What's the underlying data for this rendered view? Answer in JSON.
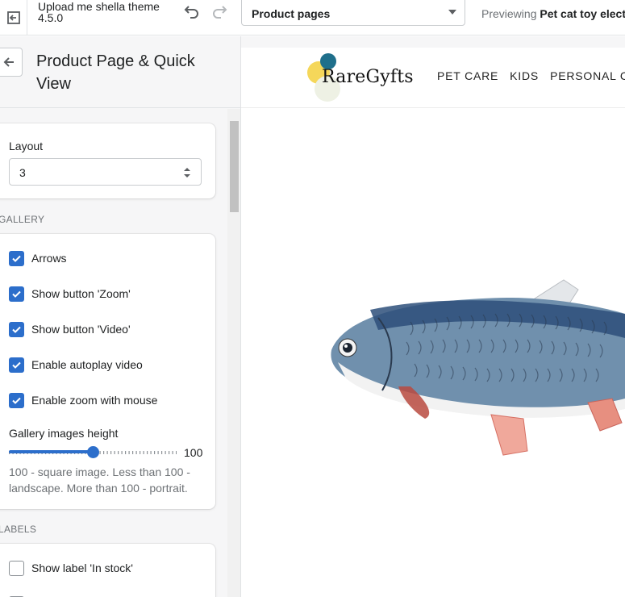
{
  "topbar": {
    "exit_icon": "exit-icon",
    "theme_name": "Upload me shella theme 4.5.0",
    "undo_icon": "undo-icon",
    "redo_icon": "redo-icon",
    "page_select": {
      "value": "Product pages"
    },
    "preview_prefix": "Previewing",
    "preview_product": "Pet cat toy electr"
  },
  "sidebar": {
    "back_icon": "arrow-left-icon",
    "title": "Product Page & Quick View",
    "layout": {
      "label": "Layout",
      "value": "3"
    },
    "gallery_heading": "GALLERY",
    "gallery_options": [
      {
        "label": "Arrows",
        "checked": true
      },
      {
        "label": "Show button 'Zoom'",
        "checked": true
      },
      {
        "label": "Show button 'Video'",
        "checked": true
      },
      {
        "label": "Enable autoplay video",
        "checked": true
      },
      {
        "label": "Enable zoom with mouse",
        "checked": true
      }
    ],
    "gallery_height": {
      "label": "Gallery images height",
      "value": "100",
      "fraction": 0.5,
      "help": "100 - square image. Less than 100 - landscape. More than 100 - portrait."
    },
    "labels_heading": "LABELS",
    "labels_options": [
      {
        "label": "Show label 'In stock'",
        "checked": false
      }
    ]
  },
  "preview": {
    "logo_text": "RareGyfts",
    "nav": [
      "PET CARE",
      "KIDS",
      "PERSONAL CAR"
    ],
    "accent": "#2c6ecb"
  }
}
